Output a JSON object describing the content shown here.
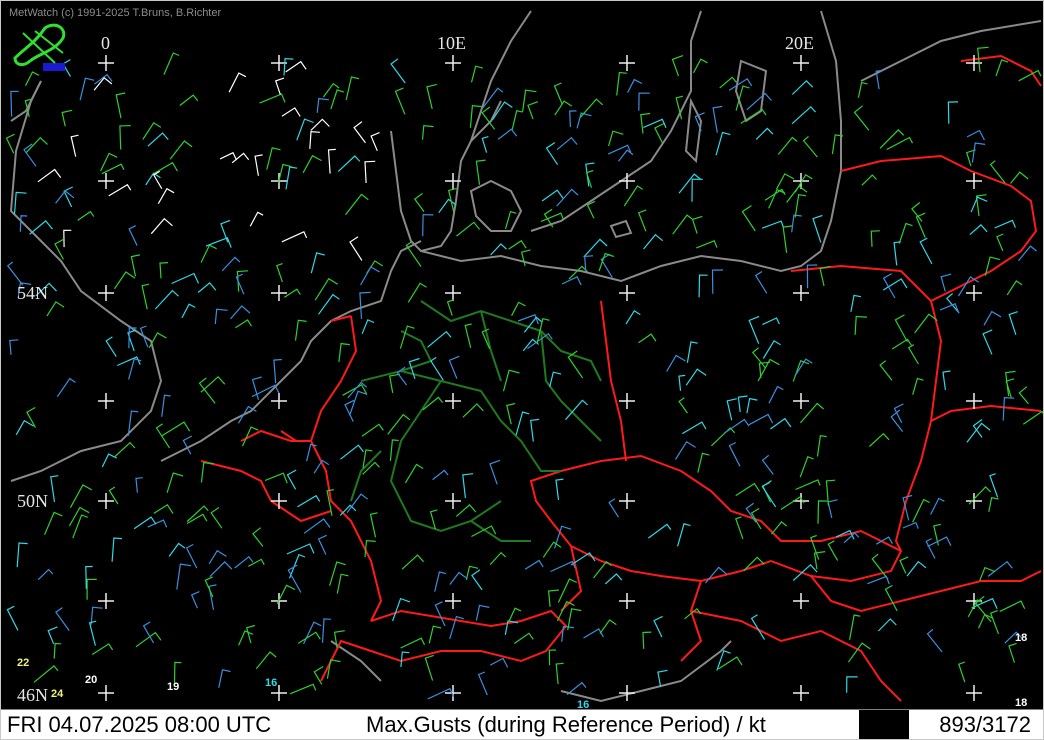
{
  "credit": "MetWatch  (c) 1991-2025 T.Bruns, B.Richter",
  "logo_icon": "metwatch-logo-icon",
  "grid_labels": {
    "lon": [
      "0",
      "10E",
      "20E"
    ],
    "lat": [
      "54N",
      "50N",
      "46N"
    ]
  },
  "station_values": [
    "22",
    "24",
    "20",
    "19",
    "16",
    "18",
    "18",
    "16"
  ],
  "status": {
    "datetime": "FRI 04.07.2025 08:00 UTC",
    "title": "Max.Gusts (during Reference Period) / kt",
    "count": "893/3172"
  },
  "colors": {
    "background": "#000000",
    "coastline": "#8a8a8a",
    "country_border": "#ff1a1a",
    "state_border": "#1f7a1f",
    "barb_green": "#2fd02f",
    "barb_blue": "#3a8fe0",
    "barb_cyan": "#30d8e8",
    "barb_white": "#ffffff"
  }
}
